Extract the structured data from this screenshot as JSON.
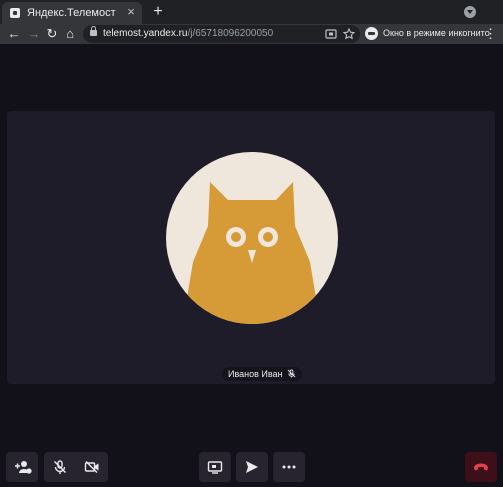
{
  "browser": {
    "tab": {
      "title": "Яндекс.Телемост",
      "close_glyph": "×",
      "favicon": "telemost-logo-icon"
    },
    "new_tab_glyph": "+",
    "toolbar": {
      "back_glyph": "←",
      "forward_glyph": "→",
      "reload_glyph": "↻",
      "home_glyph": "⌂",
      "url_host": "telemost.yandex.ru",
      "url_path": "/j/65718096200050",
      "incognito_label": "Окно в режиме инкогнито",
      "menu_glyph": "⋮"
    }
  },
  "meeting": {
    "participant_name": "Иванов Иван",
    "participant_muted": true,
    "avatar": "owl-avatar",
    "colors": {
      "background": "#121019",
      "stage": "#1f1c2a",
      "avatar_bg": "#efe6dc",
      "owl": "#d69a36",
      "hangup": "#3d0f18",
      "hangup_icon": "#e0414c"
    },
    "controls": {
      "left": [
        "add-participant-icon",
        "mic-off-icon",
        "camera-off-icon"
      ],
      "center": [
        "screen-share-icon",
        "send-icon",
        "more-icon"
      ],
      "right": [
        "hangup-icon"
      ]
    }
  }
}
